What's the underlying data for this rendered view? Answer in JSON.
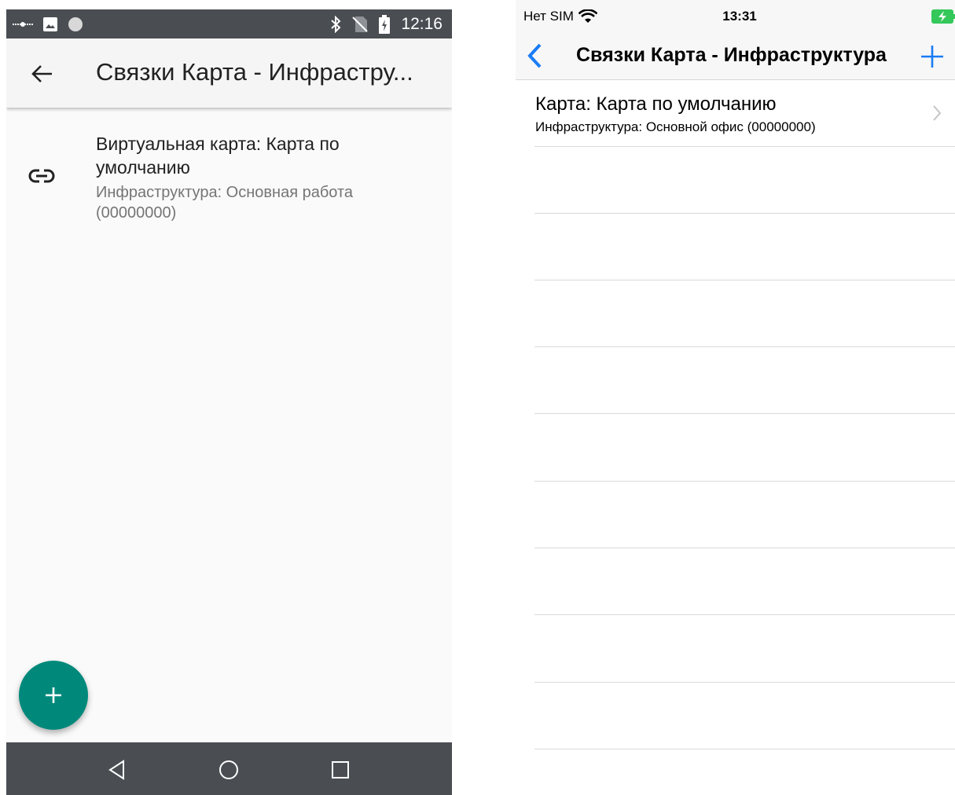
{
  "android": {
    "status_bar": {
      "time": "12:16"
    },
    "app_bar": {
      "title": "Связки Карта - Инфрастру..."
    },
    "list_item": {
      "title": "Виртуальная карта: Карта по умолчанию",
      "subtitle": "Инфраструктура: Основная работа (00000000)",
      "icon": "link-icon"
    },
    "fab": {
      "icon": "plus-icon"
    },
    "nav_bar": {
      "icons": [
        "back-triangle-icon",
        "home-circle-icon",
        "recents-square-icon"
      ]
    },
    "colors": {
      "status_bar": "#4a4e53",
      "fab": "#00897b",
      "app_bar": "#f5f5f5",
      "background": "#fafafa"
    }
  },
  "ios": {
    "status_bar": {
      "carrier": "Нет SIM",
      "time": "13:31"
    },
    "nav_bar": {
      "title": "Связки Карта - Инфраструктура",
      "back_icon": "chevron-left-icon",
      "add_icon": "plus-icon"
    },
    "rows": [
      {
        "title": "Карта: Карта по умолчанию",
        "subtitle": "Инфраструктура: Основной офис (00000000)"
      }
    ],
    "colors": {
      "tint": "#1a7cf5",
      "battery": "#34c759",
      "separator": "#d9d9d9"
    }
  }
}
